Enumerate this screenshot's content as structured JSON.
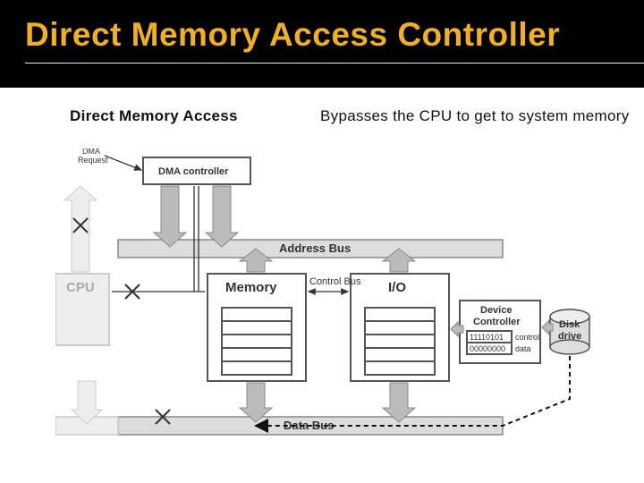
{
  "title": "Direct Memory Access Controller",
  "subhead_left": "Direct Memory Access",
  "subhead_right": "Bypasses the CPU to get to system memory",
  "labels": {
    "dma_request": "DMA\nRequest",
    "dma_controller": "DMA controller",
    "cpu": "CPU",
    "memory": "Memory",
    "io": "I/O",
    "address_bus": "Address Bus",
    "control_bus": "Control Bus",
    "data_bus": "Data Bus",
    "device_controller": "Device\nController",
    "disk_drive": "Disk\ndrive",
    "dc_control_bits": "11110101",
    "dc_data_bits": "00000000",
    "dc_control": "control",
    "dc_data": "data"
  }
}
